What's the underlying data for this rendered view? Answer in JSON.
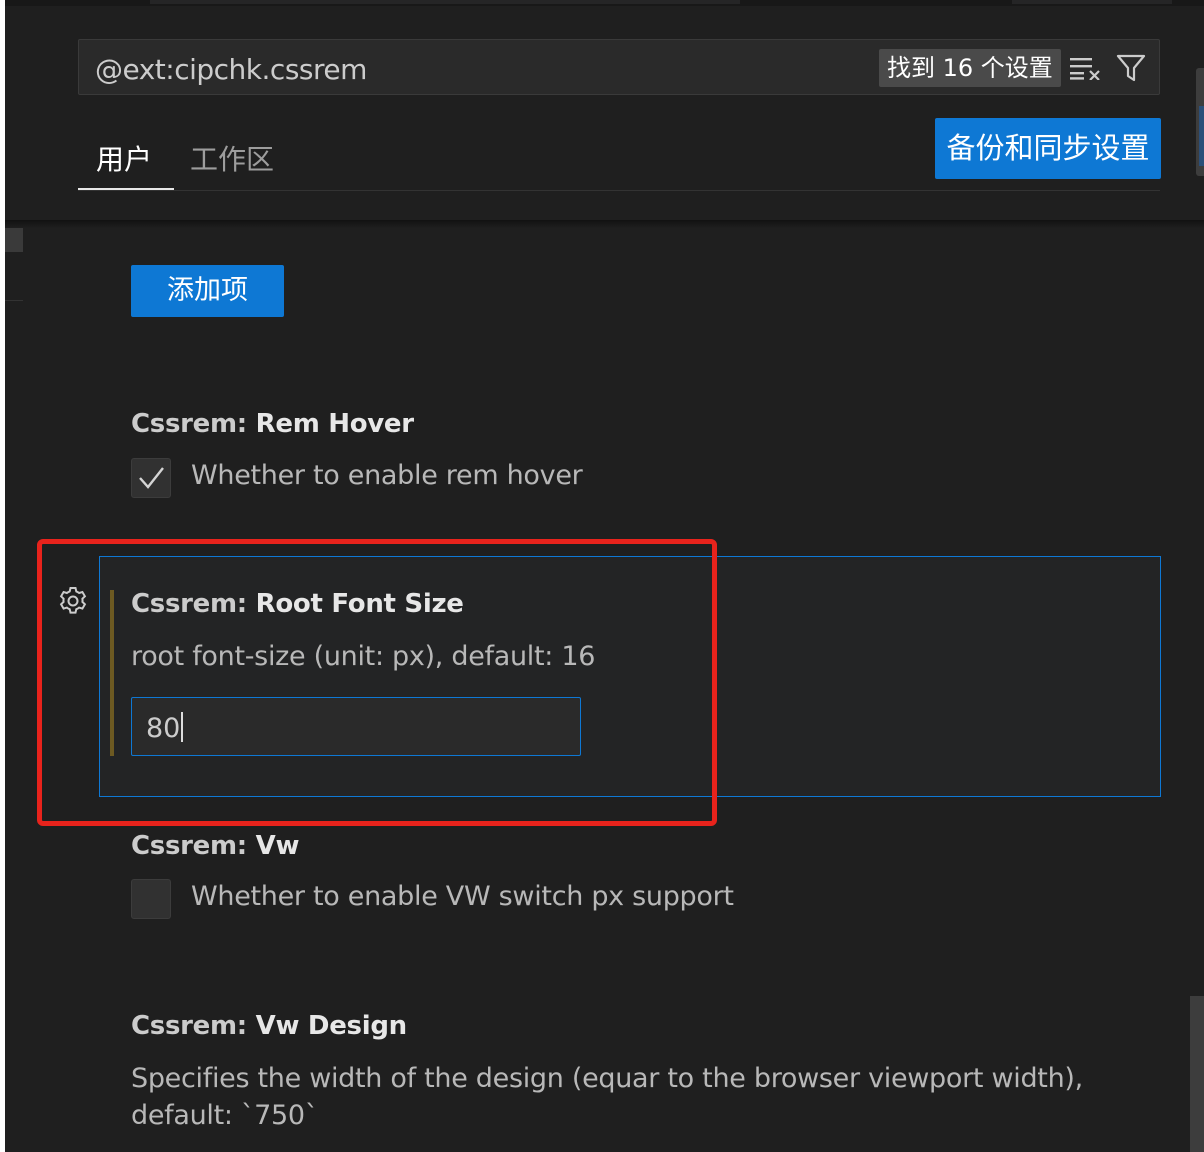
{
  "search": {
    "query": "@ext:cipchk.cssrem",
    "result_count_label": "找到 16 个设置",
    "clear_icon": "clear-filter-icon",
    "filter_icon": "filter-icon"
  },
  "tabs": [
    {
      "label": "用户",
      "active": true
    },
    {
      "label": "工作区",
      "active": false
    }
  ],
  "sync_button_label": "备份和同步设置",
  "add_item_label": "添加项",
  "settings": [
    {
      "category": "Cssrem: ",
      "name": "Rem Hover",
      "description": "Whether to enable rem hover",
      "type": "checkbox",
      "checked": true
    },
    {
      "category": "Cssrem: ",
      "name": "Root Font Size",
      "description": "root font-size (unit: px), default: 16",
      "type": "number",
      "value": "80",
      "modified": true
    },
    {
      "category": "Cssrem: ",
      "name": "Vw",
      "description": "Whether to enable VW switch px support",
      "type": "checkbox",
      "checked": false
    },
    {
      "category": "Cssrem: ",
      "name": "Vw Design",
      "description": "Specifies the width of the design (equar to the browser viewport width), default: `750`",
      "type": "text"
    }
  ],
  "colors": {
    "accent": "#0e78d4",
    "background": "#1f1f1f",
    "annotation_red": "#e8231c",
    "modified_indicator": "#6d5a22"
  }
}
